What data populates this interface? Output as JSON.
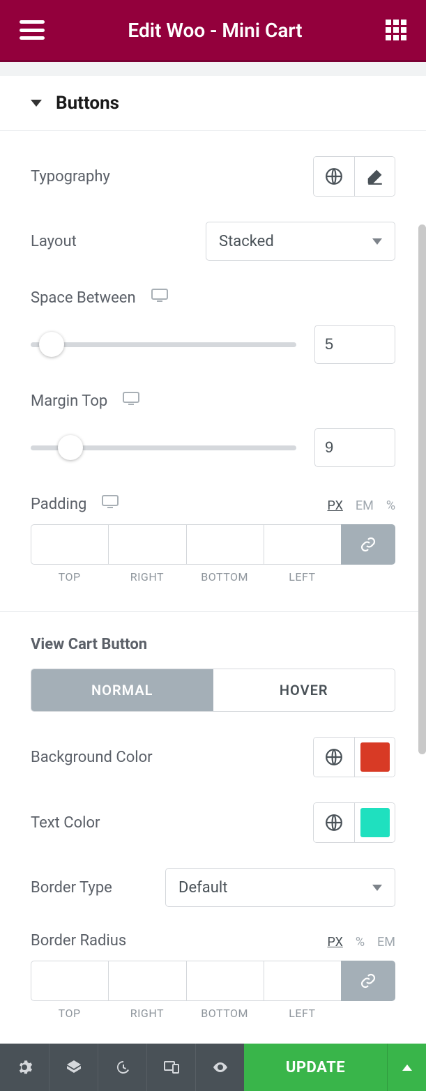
{
  "header": {
    "title": "Edit Woo - Mini Cart"
  },
  "section": {
    "title": "Buttons"
  },
  "typography": {
    "label": "Typography"
  },
  "layout": {
    "label": "Layout",
    "value": "Stacked"
  },
  "space_between": {
    "label": "Space Between",
    "value": "5",
    "slider_pct": 8
  },
  "margin_top": {
    "label": "Margin Top",
    "value": "9",
    "slider_pct": 15
  },
  "padding": {
    "label": "Padding",
    "units": {
      "px": "PX",
      "em": "EM",
      "pct": "%"
    },
    "dims": {
      "top": "TOP",
      "right": "RIGHT",
      "bottom": "BOTTOM",
      "left": "LEFT"
    }
  },
  "view_cart": {
    "heading": "View Cart Button",
    "tabs": {
      "normal": "NORMAL",
      "hover": "HOVER"
    },
    "bg": {
      "label": "Background Color",
      "color": "#d83a25"
    },
    "text": {
      "label": "Text Color",
      "color": "#1fe0bf"
    },
    "border_type": {
      "label": "Border Type",
      "value": "Default"
    },
    "border_radius": {
      "label": "Border Radius",
      "units": {
        "px": "PX",
        "pct": "%",
        "em": "EM"
      },
      "dims": {
        "top": "TOP",
        "right": "RIGHT",
        "bottom": "BOTTOM",
        "left": "LEFT"
      }
    }
  },
  "footer": {
    "update": "UPDATE"
  }
}
